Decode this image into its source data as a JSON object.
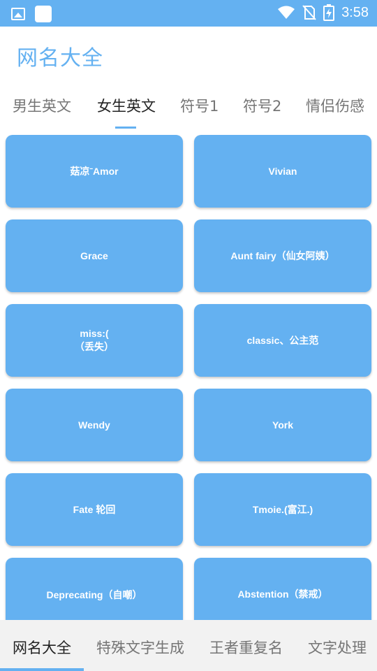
{
  "status_bar": {
    "time": "3:58",
    "icons": [
      "image-icon",
      "app-square-icon",
      "wifi-icon",
      "no-sim-icon",
      "battery-charging-icon"
    ]
  },
  "app": {
    "title": "网名大全"
  },
  "top_tabs": [
    {
      "label": "男生英文",
      "active": false
    },
    {
      "label": "女生英文",
      "active": true
    },
    {
      "label": "符号1",
      "active": false
    },
    {
      "label": "符号2",
      "active": false
    },
    {
      "label": "情侣伤感",
      "active": false
    }
  ],
  "names": [
    "菇凉ˉAmor",
    "Vivian",
    "Grace",
    "Aunt fairy（仙女阿姨）",
    "miss:(\n（丢失）",
    "classic、公主范",
    "Wendy",
    "York",
    "Fate 轮回",
    "Tmoie.(富江.)",
    "Deprecating（自嘲）",
    "Abstention（禁戒）"
  ],
  "bottom_nav": [
    {
      "label": "网名大全",
      "active": true
    },
    {
      "label": "特殊文字生成",
      "active": false
    },
    {
      "label": "王者重复名",
      "active": false
    },
    {
      "label": "文字处理",
      "active": false
    }
  ],
  "colors": {
    "accent": "#64b1f1",
    "card": "#64b1f1",
    "text_active": "#222222",
    "text_inactive": "#757575"
  }
}
